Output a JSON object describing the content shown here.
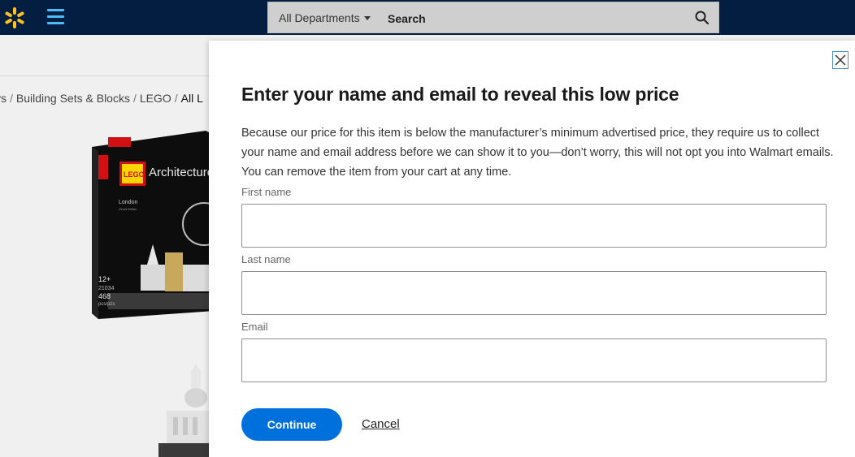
{
  "header": {
    "logo_icon": "walmart-spark-icon",
    "menu_icon": "hamburger-menu-icon",
    "department_selector": "All Departments",
    "search_placeholder": "Search",
    "search_icon": "magnifier-icon",
    "colors": {
      "bar": "#041e42",
      "spark": "#ffc220",
      "menu": "#4dbdf5"
    }
  },
  "background_page": {
    "breadcrumb": [
      "ys",
      "Building Sets & Blocks",
      "LEGO",
      "All L"
    ],
    "product_box": {
      "brand": "LEGO",
      "line": "Architecture",
      "subtitle": "London",
      "subtitle2": "Great Britain",
      "age": "12+",
      "set_number": "21034",
      "pieces": "468",
      "pieces_label": "pcs/pzs"
    }
  },
  "modal": {
    "title": "Enter your name and email to reveal this low price",
    "description": "Because our price for this item is below the manufacturer’s minimum advertised price, they require us to collect your name and email address before we can show it to you—don’t worry, this will not opt you into Walmart emails. You can remove the item from your cart at any time.",
    "close_icon": "close-x-icon",
    "fields": [
      {
        "label": "First name",
        "value": ""
      },
      {
        "label": "Last name",
        "value": ""
      },
      {
        "label": "Email",
        "value": ""
      }
    ],
    "continue_label": "Continue",
    "cancel_label": "Cancel",
    "colors": {
      "primary_button": "#0071dc",
      "close_border": "#4a90d9"
    }
  }
}
